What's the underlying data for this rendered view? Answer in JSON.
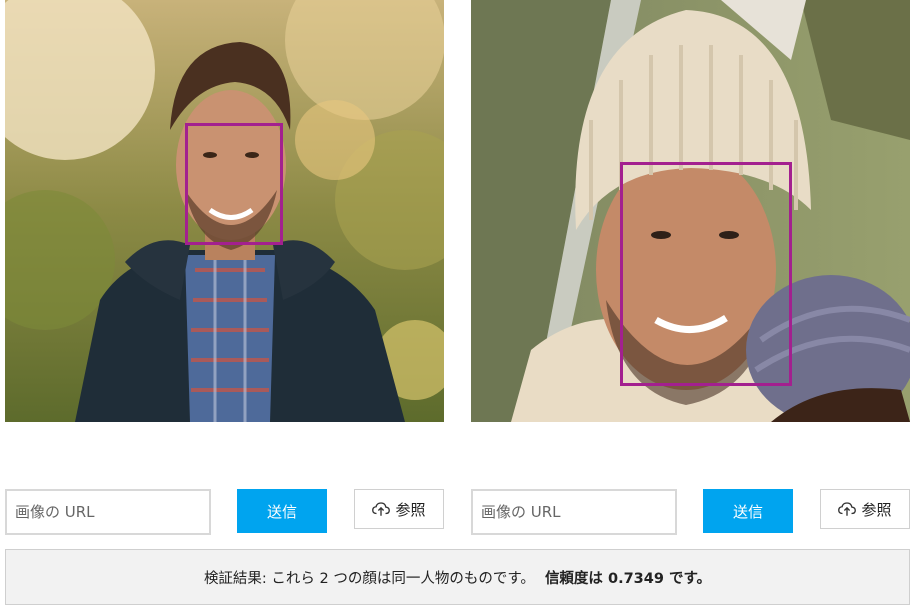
{
  "left_panel": {
    "image": {
      "kind": "photo",
      "subject": "man-with-beard-outdoors",
      "face_detected": true
    },
    "url_input": {
      "placeholder": "画像の URL",
      "value": ""
    },
    "send_label": "送信",
    "browse_label": "参照",
    "browse_icon": "cloud-upload-icon"
  },
  "right_panel": {
    "image": {
      "kind": "photo",
      "subject": "man-with-knit-hat-and-child",
      "face_detected": true
    },
    "url_input": {
      "placeholder": "画像の URL",
      "value": ""
    },
    "send_label": "送信",
    "browse_label": "参照",
    "browse_icon": "cloud-upload-icon"
  },
  "result": {
    "message": "検証結果: これら 2 つの顔は同一人物のものです。",
    "confidence_text": "信頼度は 0.7349 です。"
  },
  "colors": {
    "face_box": "#a3208f",
    "send_button": "#00a4ef",
    "result_background": "#f2f2f2"
  }
}
